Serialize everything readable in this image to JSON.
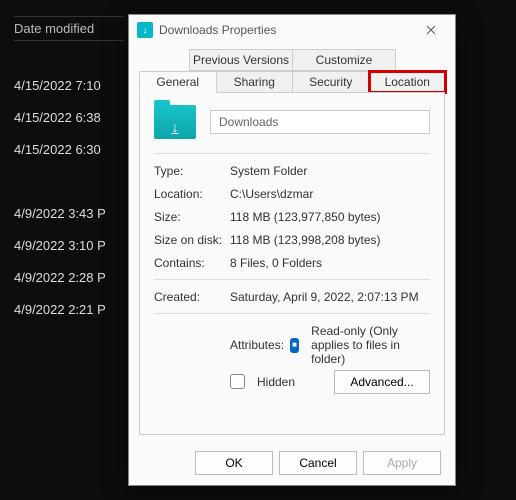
{
  "bg": {
    "header": "Date modified",
    "items": [
      "4/15/2022 7:10",
      "4/15/2022 6:38",
      "4/15/2022 6:30",
      "4/9/2022 3:43 P",
      "4/9/2022 3:10 P",
      "4/9/2022 2:28 P",
      "4/9/2022 2:21 P"
    ]
  },
  "dialog": {
    "title": "Downloads Properties",
    "tabs_row1": [
      "Previous Versions",
      "Customize"
    ],
    "tabs_row2": [
      "General",
      "Sharing",
      "Security",
      "Location"
    ],
    "folder_name": "Downloads",
    "props": {
      "type_label": "Type:",
      "type_value": "System Folder",
      "location_label": "Location:",
      "location_value": "C:\\Users\\dzmar",
      "size_label": "Size:",
      "size_value": "118 MB (123,977,850 bytes)",
      "sizeondisk_label": "Size on disk:",
      "sizeondisk_value": "118 MB (123,998,208 bytes)",
      "contains_label": "Contains:",
      "contains_value": "8 Files, 0 Folders",
      "created_label": "Created:",
      "created_value": "Saturday, April 9, 2022, 2:07:13 PM",
      "attributes_label": "Attributes:",
      "readonly_label": "Read-only (Only applies to files in folder)",
      "hidden_label": "Hidden",
      "advanced_label": "Advanced..."
    },
    "buttons": {
      "ok": "OK",
      "cancel": "Cancel",
      "apply": "Apply"
    }
  }
}
